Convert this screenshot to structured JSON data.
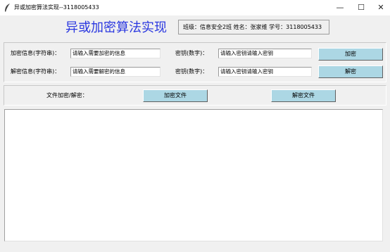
{
  "window": {
    "title": "异或加密算法实现--3118005433",
    "minimize_glyph": "—",
    "maximize_glyph": "☐",
    "close_glyph": "✕",
    "icon": "feather-icon"
  },
  "header": {
    "title": "异或加密算法实现",
    "info": "班级：信息安全2班    姓名：张家维 学号：3118005433",
    "title_color": "#2a37e0"
  },
  "encrypt_row": {
    "info_label": "加密信息(字符串)：",
    "info_value": "请输入需要加密的信息",
    "key_label": "密钥(数字)：",
    "key_value": "请输入密钥请输入密钥",
    "button": "加密"
  },
  "decrypt_row": {
    "info_label": "解密信息(字符串)：",
    "info_value": "请输入需要解密的信息",
    "key_label": "密钥(数字)：",
    "key_value": "请输入密钥请输入密钥",
    "button": "解密"
  },
  "file_row": {
    "label": "文件加密/解密：",
    "encrypt_button": "加密文件",
    "decrypt_button": "解密文件"
  },
  "output": {
    "text": ""
  },
  "colors": {
    "button_bg": "#acd7e4",
    "window_bg": "#f0f0f0"
  }
}
